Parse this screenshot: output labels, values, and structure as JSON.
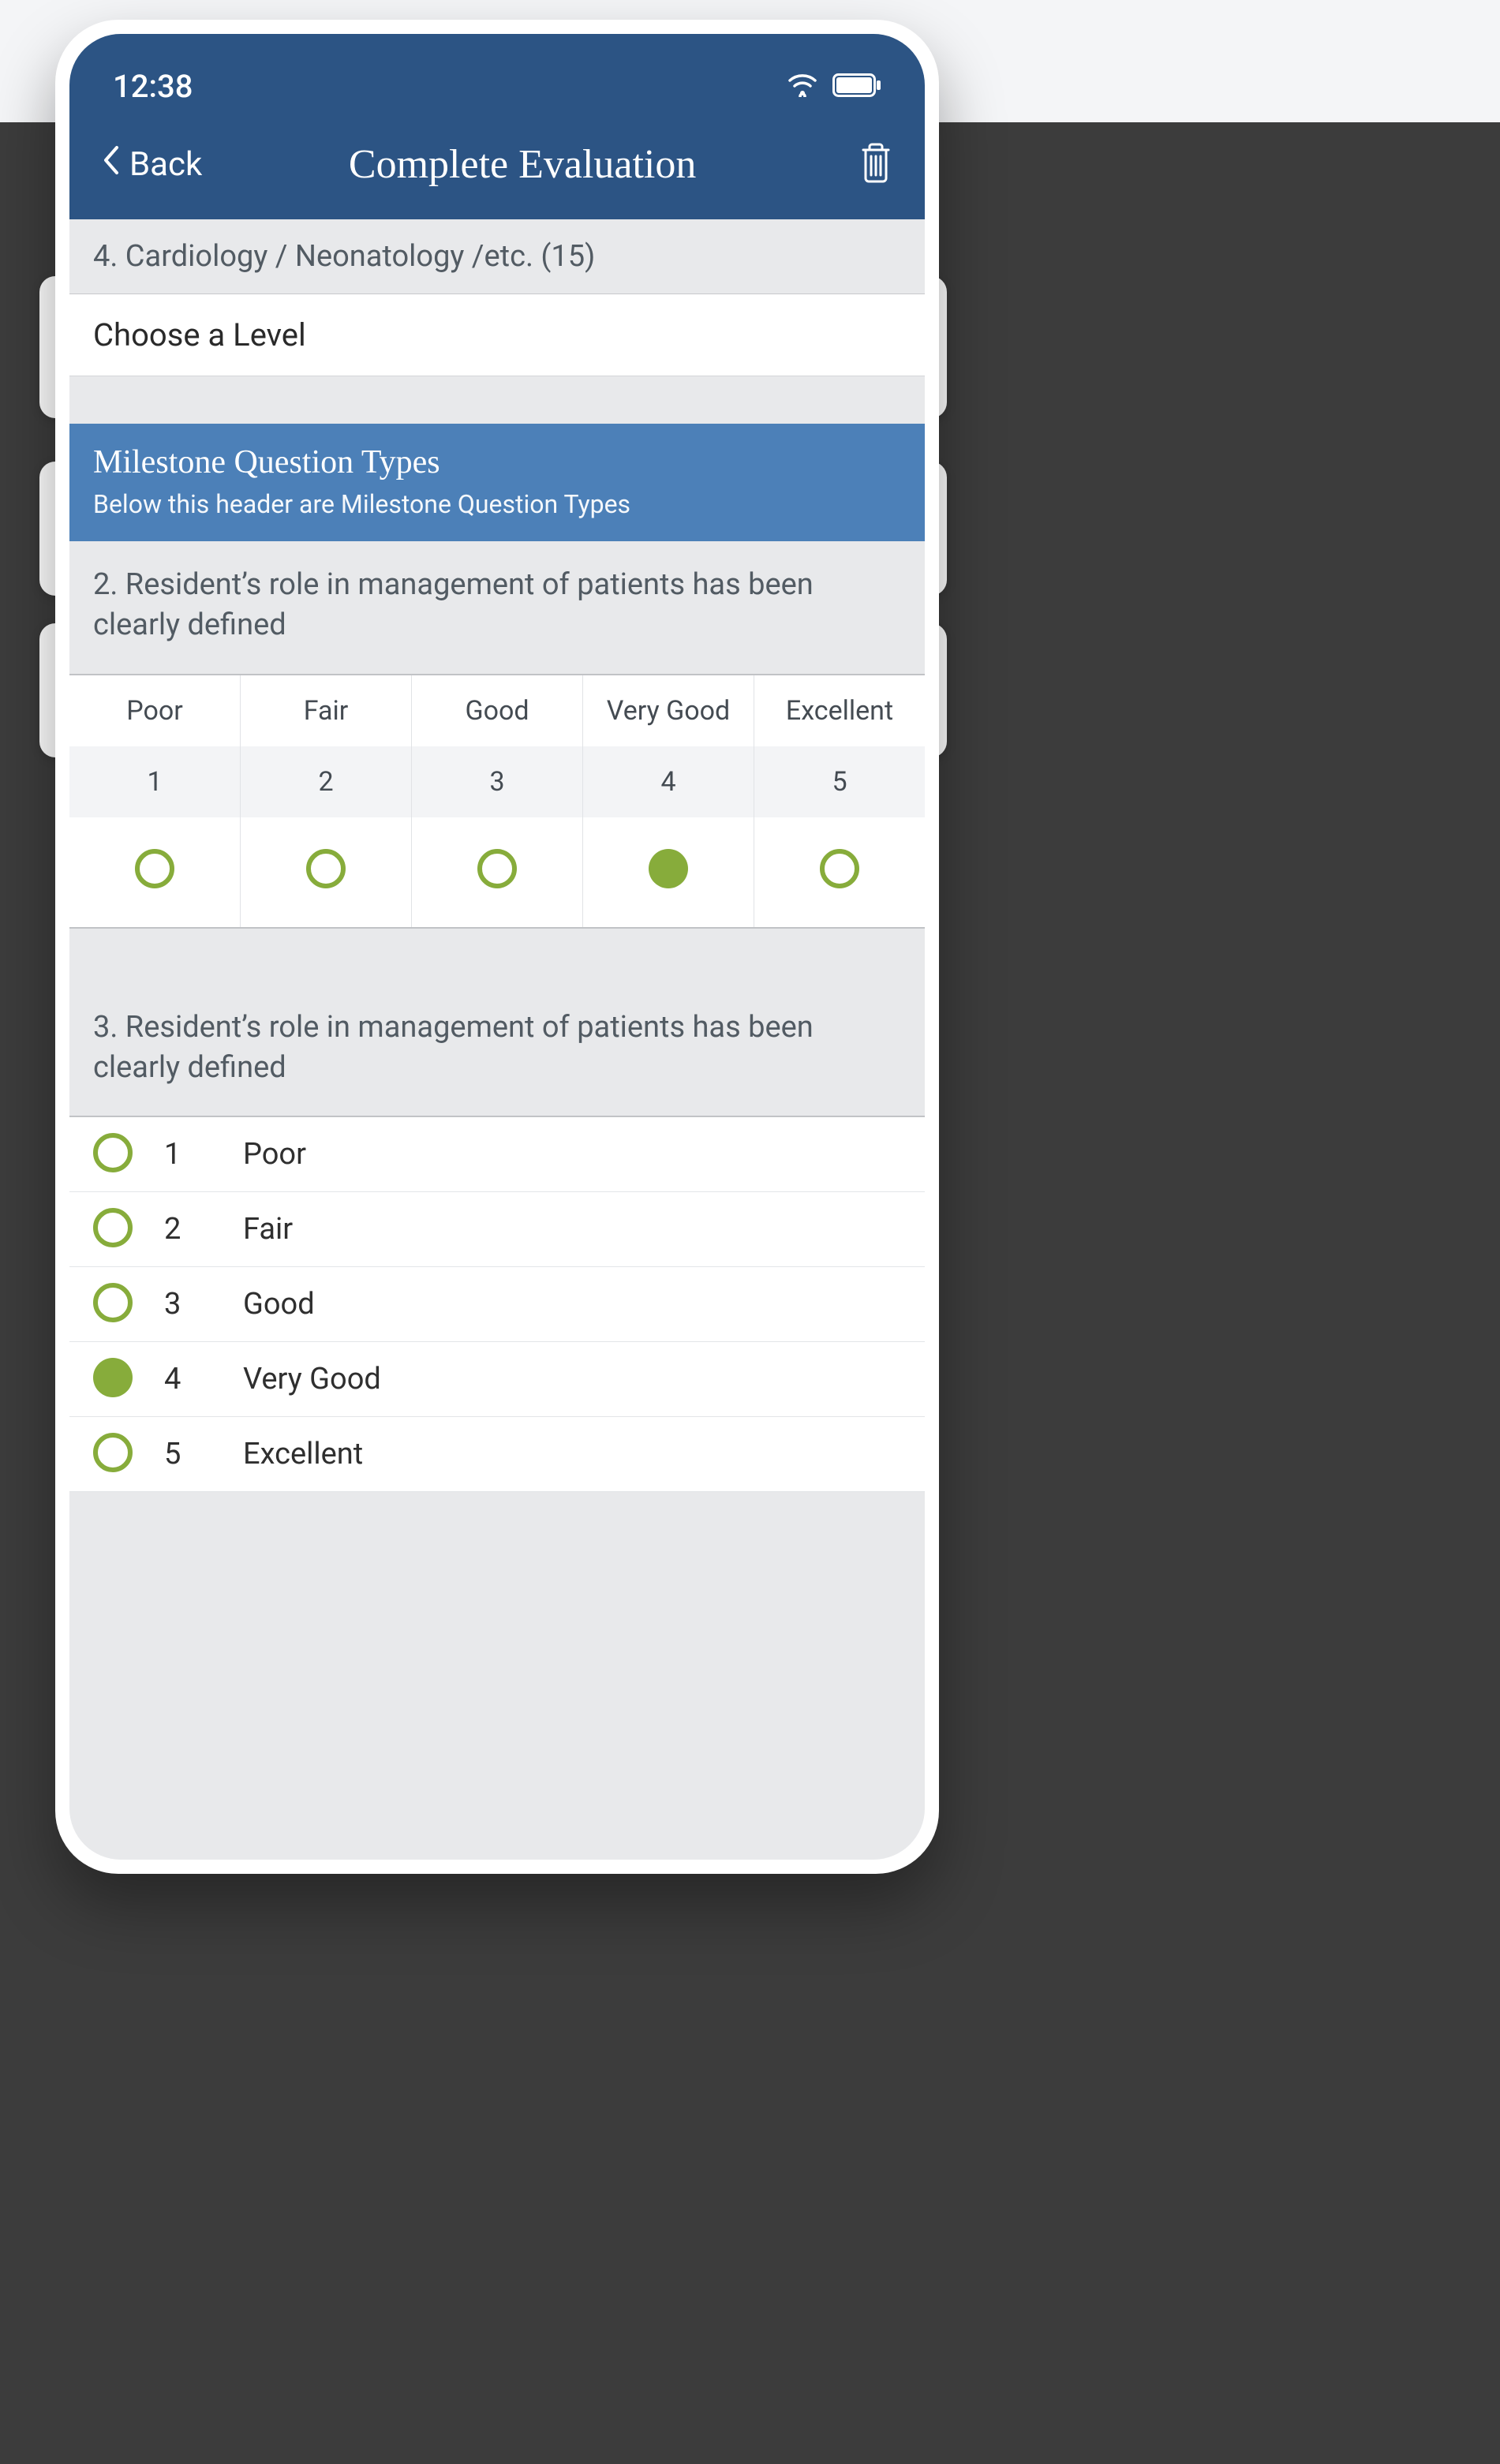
{
  "statusbar": {
    "time": "12:38"
  },
  "nav": {
    "back": "Back",
    "title": "Complete Evaluation"
  },
  "section4": {
    "title": "4. Cardiology / Neonatology /etc. (15)"
  },
  "chooseLevel": {
    "label": "Choose a Level"
  },
  "milestone": {
    "title": "Milestone Question Types",
    "subtitle": "Below this header are Milestone Question Types"
  },
  "q2": {
    "text": "2. Resident’s role in management of patients has been clearly defined",
    "headers": [
      "Poor",
      "Fair",
      "Good",
      "Very Good",
      "Excellent"
    ],
    "numbers": [
      "1",
      "2",
      "3",
      "4",
      "5"
    ],
    "selected": 3
  },
  "q3": {
    "text": "3. Resident’s role in management of patients has been clearly defined",
    "options": [
      {
        "num": "1",
        "label": "Poor"
      },
      {
        "num": "2",
        "label": "Fair"
      },
      {
        "num": "3",
        "label": "Good"
      },
      {
        "num": "4",
        "label": "Very Good"
      },
      {
        "num": "5",
        "label": "Excellent"
      }
    ],
    "selected": 3
  },
  "colors": {
    "navy": "#2c5484",
    "blue": "#4c80b8",
    "green": "#87ac3b"
  }
}
